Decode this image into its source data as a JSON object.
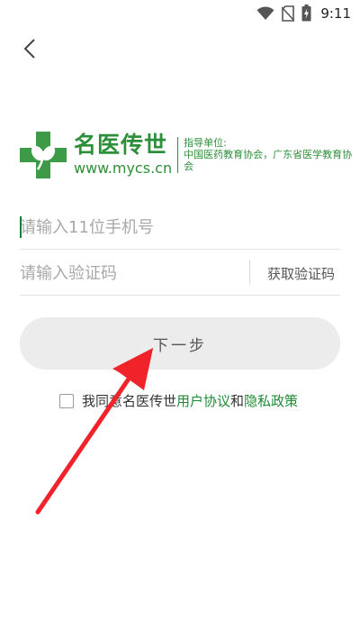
{
  "status_bar": {
    "time": "9:11",
    "icons": [
      "wifi-icon",
      "no-sim-icon",
      "battery-charging-icon"
    ]
  },
  "header": {
    "back_icon": "chevron-left-icon"
  },
  "brand": {
    "name": "名医传世",
    "url": "www.mycs.cn",
    "guide_title": "指导单位:",
    "guide_orgs": "中国医药教育协会，广东省医学教育协会",
    "logo_icon": "green-cross-leaf-icon"
  },
  "form": {
    "phone_placeholder": "请输入11位手机号",
    "code_placeholder": "请输入验证码",
    "get_code_label": "获取验证码",
    "next_label": "下一步"
  },
  "agreement": {
    "prefix": "我同意名医传世",
    "user_agreement": "用户协议",
    "connector": "和",
    "privacy_policy": "隐私政策"
  },
  "colors": {
    "brand_green": "#2d8f3a",
    "link_green": "#1e8b34",
    "button_bg": "#ececec",
    "annotation_arrow": "#f0232b"
  }
}
